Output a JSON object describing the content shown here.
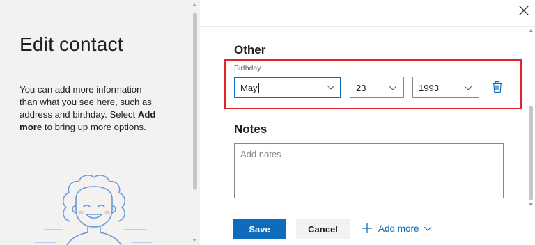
{
  "left": {
    "title": "Edit contact",
    "description_1": "You can add more information than what you see here, such as address and birthday. Select ",
    "description_bold": "Add more",
    "description_2": " to bring up more options."
  },
  "other": {
    "title": "Other",
    "birthday_label": "Birthday",
    "month": "May",
    "day": "23",
    "year": "1993"
  },
  "notes": {
    "title": "Notes",
    "placeholder": "Add notes",
    "value": ""
  },
  "footer": {
    "save_label": "Save",
    "cancel_label": "Cancel",
    "add_more_label": "Add more"
  },
  "colors": {
    "accent": "#0f6cbd",
    "highlight_box": "#e0242a",
    "left_panel_bg": "#f3f2f1"
  },
  "icons": [
    "close-icon",
    "chevron-down-icon",
    "trash-icon",
    "plus-icon",
    "avatar-illustration"
  ]
}
